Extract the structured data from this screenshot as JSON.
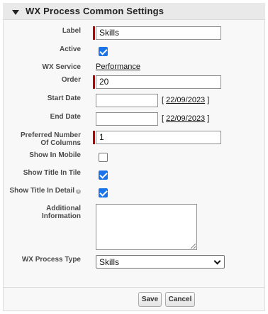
{
  "section": {
    "title": "WX Process Common Settings"
  },
  "fields": {
    "label": {
      "label": "Label",
      "value": "Skills"
    },
    "active": {
      "label": "Active",
      "checked": true
    },
    "wx_service": {
      "label": "WX Service",
      "value": "Performance"
    },
    "order": {
      "label": "Order",
      "value": "20"
    },
    "start_date": {
      "label": "Start Date",
      "value": "",
      "hint_open": "[ ",
      "hint_date": "22/09/2023",
      "hint_close": " ]"
    },
    "end_date": {
      "label": "End Date",
      "value": "",
      "hint_open": "[ ",
      "hint_date": "22/09/2023",
      "hint_close": " ]"
    },
    "preferred_columns": {
      "label_line1": "Preferred Number",
      "label_line2": "Of Columns",
      "value": "1"
    },
    "show_in_mobile": {
      "label": "Show In Mobile",
      "checked": false
    },
    "show_title_in_tile": {
      "label": "Show Title In Tile",
      "checked": true
    },
    "show_title_in_detail": {
      "label": "Show Title In Detail",
      "checked": true,
      "help_icon": "?"
    },
    "additional_information": {
      "label_line1": "Additional",
      "label_line2": "Information",
      "value": ""
    },
    "wx_process_type": {
      "label": "WX Process Type",
      "value": "Skills"
    }
  },
  "buttons": {
    "save": "Save",
    "cancel": "Cancel"
  },
  "colors": {
    "required": "#c00000",
    "checkbox": "#1a73e8",
    "header_bg": "#e9e9e9"
  }
}
